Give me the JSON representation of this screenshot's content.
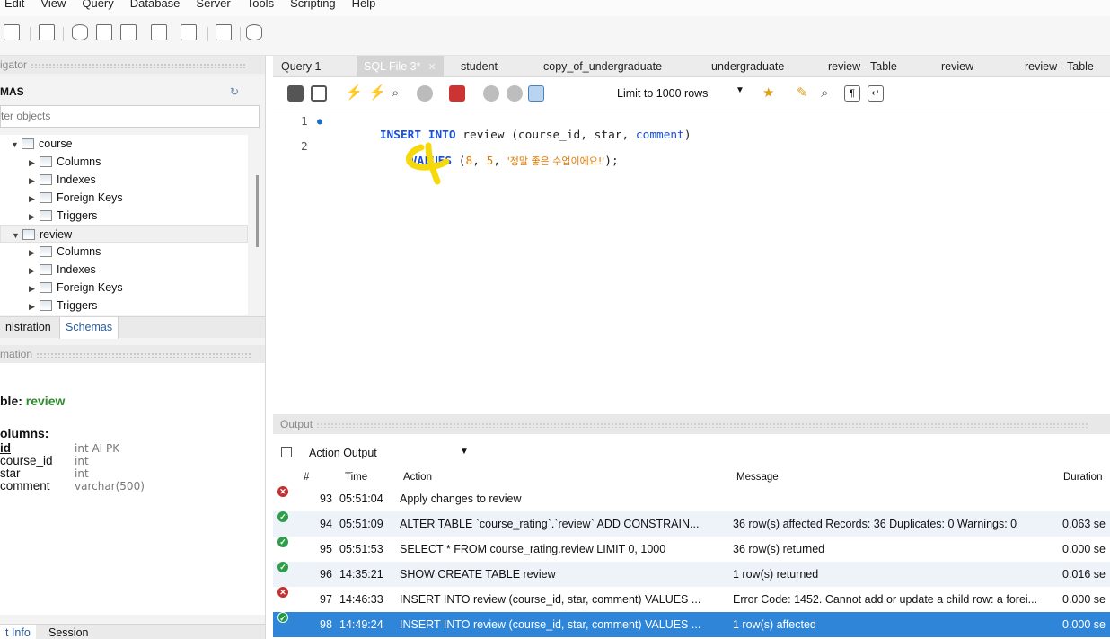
{
  "menu": [
    "Edit",
    "View",
    "Query",
    "Database",
    "Server",
    "Tools",
    "Scripting",
    "Help"
  ],
  "navigator": {
    "header": "igator",
    "schemas_title": "MAS",
    "filter_placeholder": "ter objects",
    "tree": [
      {
        "label": "course",
        "kind": "table",
        "expanded": true
      },
      {
        "label": "Columns",
        "kind": "folder"
      },
      {
        "label": "Indexes",
        "kind": "folder"
      },
      {
        "label": "Foreign Keys",
        "kind": "folder"
      },
      {
        "label": "Triggers",
        "kind": "folder"
      },
      {
        "label": "review",
        "kind": "table",
        "expanded": true,
        "selected": true
      },
      {
        "label": "Columns",
        "kind": "folder"
      },
      {
        "label": "Indexes",
        "kind": "folder"
      },
      {
        "label": "Foreign Keys",
        "kind": "folder"
      },
      {
        "label": "Triggers",
        "kind": "folder"
      }
    ],
    "tabs": [
      "nistration",
      "Schemas"
    ],
    "info_header": "mation",
    "info_table_label": "ble:",
    "info_table_name": "review",
    "info_columns_label": "olumns:",
    "columns": [
      {
        "name": "id",
        "type": "int AI PK"
      },
      {
        "name": "course_id",
        "type": "int"
      },
      {
        "name": "star",
        "type": "int"
      },
      {
        "name": "comment",
        "type": "varchar(500)"
      }
    ],
    "bottom_tabs": [
      "t Info",
      "Session"
    ]
  },
  "editor_tabs": [
    {
      "label": "Query 1"
    },
    {
      "label": "SQL File 3*",
      "active": true
    },
    {
      "label": "student"
    },
    {
      "label": "copy_of_undergraduate"
    },
    {
      "label": "undergraduate"
    },
    {
      "label": "review - Table"
    },
    {
      "label": "review"
    },
    {
      "label": "review - Table"
    }
  ],
  "sql_toolbar": {
    "limit_label": "Limit to 1000 rows"
  },
  "editor": {
    "lines": [
      {
        "num": "1",
        "kw1": "INSERT INTO",
        "ident": " review (course_id, star, ",
        "col": "comment",
        "end": ")"
      },
      {
        "num": "2",
        "kw1": "VALUES",
        "pre": " (",
        "v1": "8",
        "sep1": ", ",
        "v2": "5",
        "sep2": ", ",
        "str": "'정말 좋은 수업이에요!'",
        "end": ");"
      }
    ]
  },
  "output": {
    "header": "Output",
    "selector": "Action Output",
    "columns": [
      "#",
      "Time",
      "Action",
      "Message",
      "Duration"
    ],
    "rows": [
      {
        "status": "error",
        "num": "93",
        "time": "05:51:04",
        "action": "Apply changes to review",
        "message": "",
        "duration": ""
      },
      {
        "status": "ok",
        "num": "94",
        "time": "05:51:09",
        "action": "ALTER TABLE `course_rating`.`review` ADD CONSTRAIN...",
        "message": "36 row(s) affected Records: 36  Duplicates: 0  Warnings: 0",
        "duration": "0.063 se"
      },
      {
        "status": "ok",
        "num": "95",
        "time": "05:51:53",
        "action": "SELECT * FROM course_rating.review LIMIT 0, 1000",
        "message": "36 row(s) returned",
        "duration": "0.000 se"
      },
      {
        "status": "ok",
        "num": "96",
        "time": "14:35:21",
        "action": "SHOW CREATE TABLE review",
        "message": "1 row(s) returned",
        "duration": "0.016 se"
      },
      {
        "status": "error",
        "num": "97",
        "time": "14:46:33",
        "action": "INSERT INTO review (course_id, star, comment) VALUES ...",
        "message": "Error Code: 1452. Cannot add or update a child row: a forei...",
        "duration": "0.000 se"
      },
      {
        "status": "ok",
        "num": "98",
        "time": "14:49:24",
        "action": "INSERT INTO review (course_id, star, comment) VALUES ...",
        "message": "1 row(s) affected",
        "duration": "0.000 se",
        "selected": true
      }
    ]
  },
  "colors": {
    "accent": "#1a4fd6",
    "selected_row": "#2f86d8",
    "ok": "#2e9e4a",
    "error": "#c43030",
    "string": "#e07a00",
    "annotation": "#f5d90a"
  }
}
